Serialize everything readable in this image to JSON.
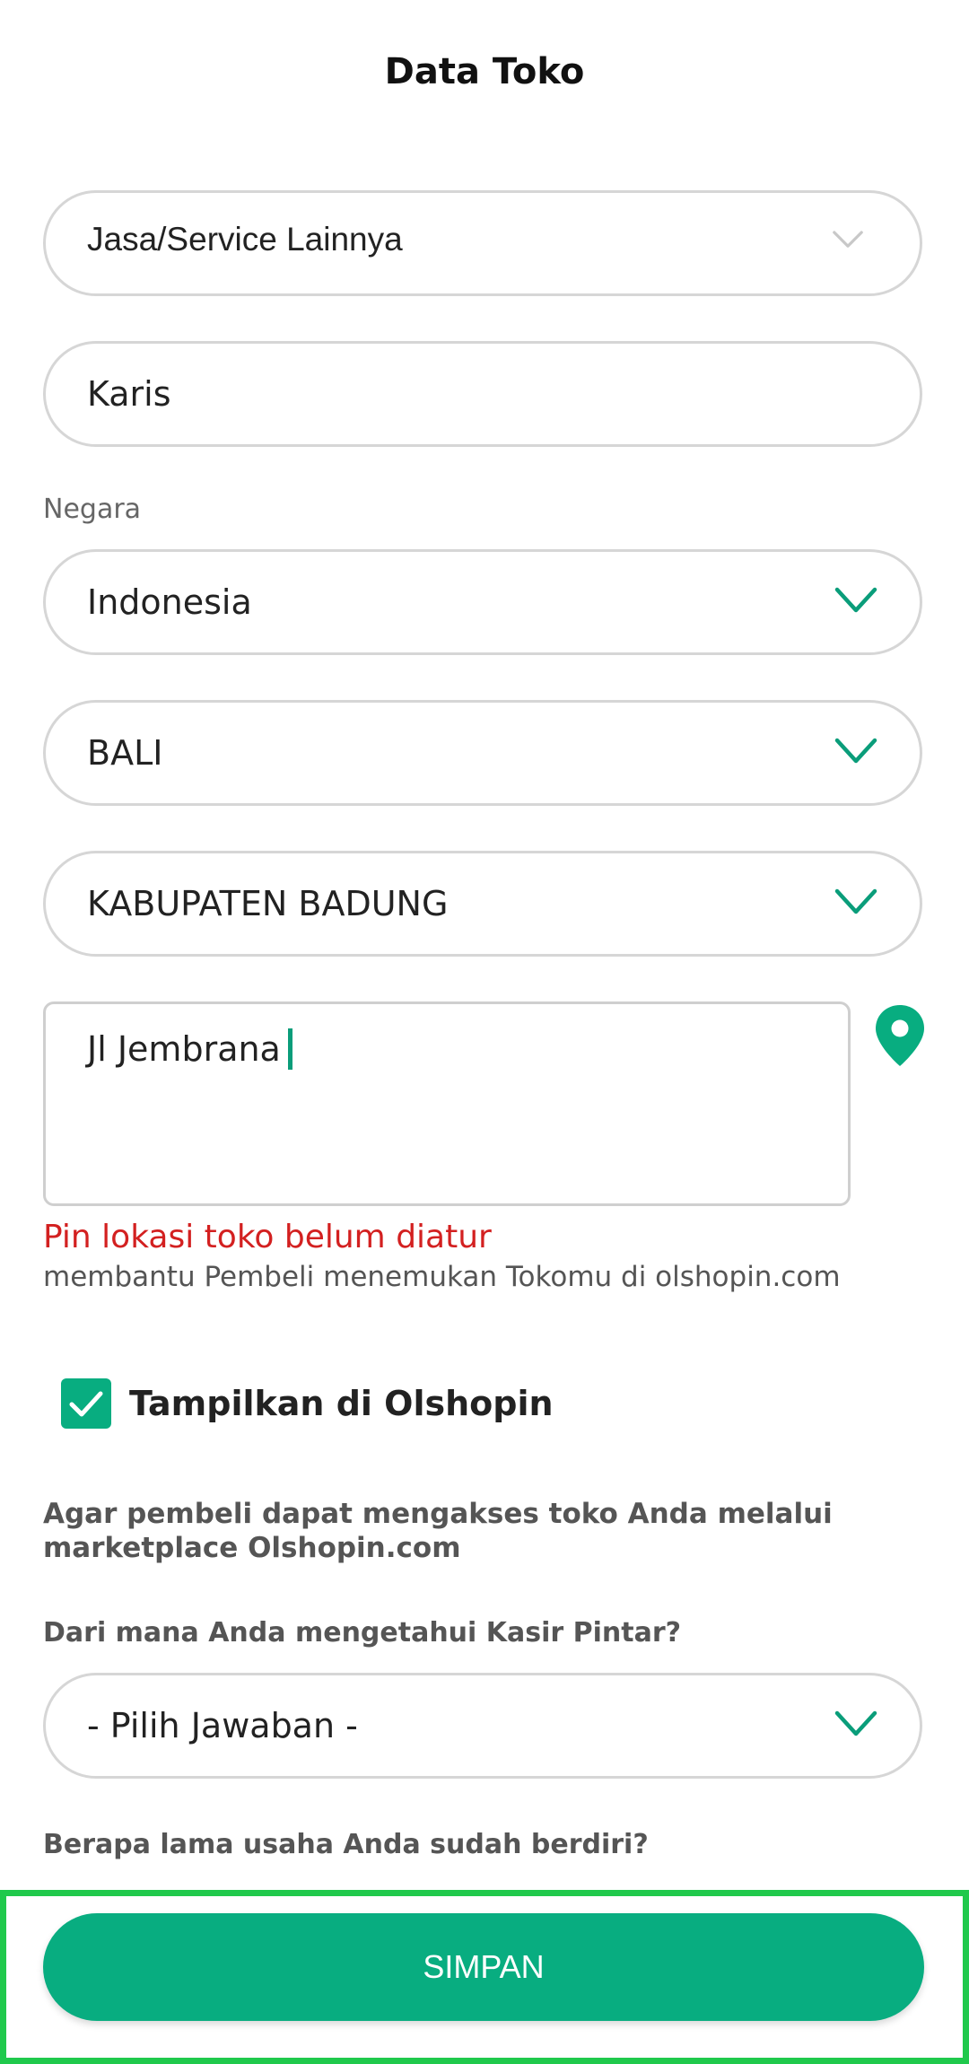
{
  "page_title": "Data Toko",
  "category": {
    "value": "Jasa/Service Lainnya"
  },
  "store_name": {
    "value": "Karis"
  },
  "country": {
    "label": "Negara",
    "value": "Indonesia"
  },
  "province": {
    "value": "BALI"
  },
  "city": {
    "value": "KABUPATEN BADUNG"
  },
  "address": {
    "value": "Jl Jembrana"
  },
  "location_pin": {
    "icon": "map-pin-icon",
    "error": "Pin lokasi toko belum diatur",
    "help": "membantu Pembeli menemukan Tokomu di olshopin.com"
  },
  "olshopin": {
    "checked": true,
    "label": "Tampilkan di Olshopin",
    "description": "Agar pembeli dapat mengakses toko Anda melalui marketplace Olshopin.com"
  },
  "source_question": {
    "label": "Dari mana Anda mengetahui Kasir Pintar?",
    "value": "- Pilih Jawaban -"
  },
  "duration_question": {
    "label": "Berapa lama usaha Anda sudah berdiri?"
  },
  "save_button": {
    "label": "SIMPAN"
  },
  "colors": {
    "accent": "#08ad80",
    "error": "#d32020",
    "highlight_border": "#20c94c",
    "chevron_disabled": "#c8c8c8"
  }
}
